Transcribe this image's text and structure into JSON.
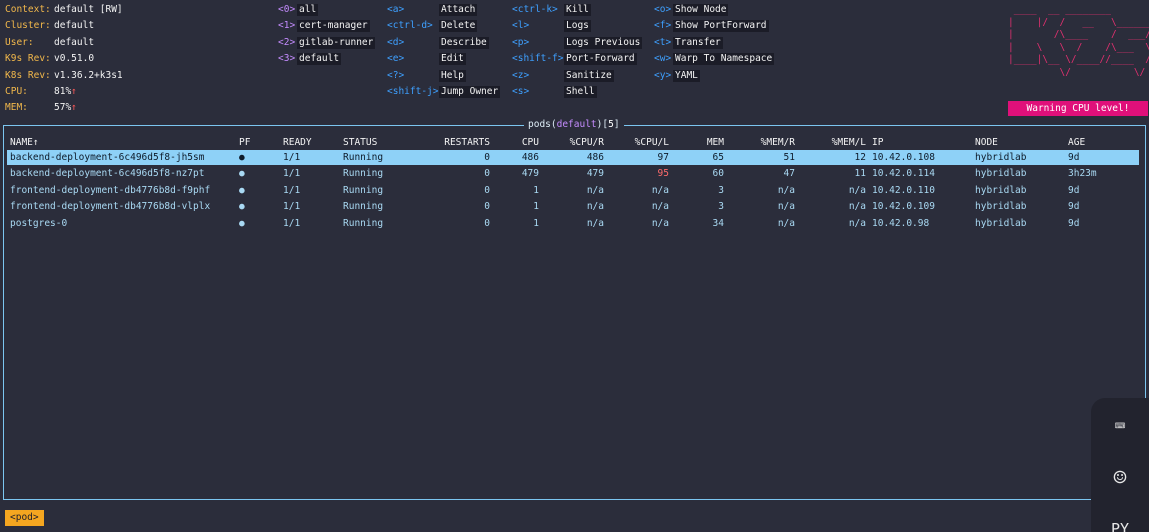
{
  "info": [
    {
      "label": "Context:",
      "value": "default [RW]",
      "key": "<0>",
      "ns": "all"
    },
    {
      "label": "Cluster:",
      "value": "default",
      "key": "<1>",
      "ns": "cert-manager"
    },
    {
      "label": "User:",
      "value": "default",
      "key": "<2>",
      "ns": "gitlab-runner"
    },
    {
      "label": "K9s Rev:",
      "value": "v0.51.0",
      "key": "<3>",
      "ns": "default"
    },
    {
      "label": "K8s Rev:",
      "value": "v1.36.2+k3s1"
    },
    {
      "label": "CPU:",
      "value": "81%",
      "arrow": "↑"
    },
    {
      "label": "MEM:",
      "value": "57%",
      "arrow": "↑"
    }
  ],
  "hotkeys_col1": [
    {
      "key": "<a>",
      "action": "Attach"
    },
    {
      "key": "<ctrl-d>",
      "action": "Delete"
    },
    {
      "key": "<d>",
      "action": "Describe"
    },
    {
      "key": "<e>",
      "action": "Edit"
    },
    {
      "key": "<?>",
      "action": "Help"
    },
    {
      "key": "<shift-j>",
      "action": "Jump Owner"
    }
  ],
  "hotkeys_col2": [
    {
      "key": "<ctrl-k>",
      "action": "Kill"
    },
    {
      "key": "<l>",
      "action": "Logs"
    },
    {
      "key": "<p>",
      "action": "Logs Previous"
    },
    {
      "key": "<shift-f>",
      "action": "Port-Forward"
    },
    {
      "key": "<z>",
      "action": "Sanitize"
    },
    {
      "key": "<s>",
      "action": "Shell"
    }
  ],
  "hotkeys_col3": [
    {
      "key": "<o>",
      "action": "Show Node"
    },
    {
      "key": "<f>",
      "action": "Show PortForward"
    },
    {
      "key": "<t>",
      "action": "Transfer"
    },
    {
      "key": "<w>",
      "action": "Warp To Namespace"
    },
    {
      "key": "<y>",
      "action": "YAML"
    }
  ],
  "logo_lines": [
    " ____  __ ________       ",
    "|    |/  /   __   \\______",
    "|       /\\____    /  ___/",
    "|    \\   \\  /    /\\___  \\",
    "|____|\\__ \\/____//____  /",
    "         \\/           \\/ "
  ],
  "warning": "Warning CPU level!",
  "pods": {
    "title_prefix": "pods(",
    "namespace": "default",
    "title_mid": ")[",
    "count": "5",
    "title_suffix": "]",
    "headers": {
      "name": "NAME↑",
      "pf": "PF",
      "ready": "READY",
      "status": "STATUS",
      "restarts": "RESTARTS",
      "cpu": "CPU",
      "cpu_r": "%CPU/R",
      "cpu_l": "%CPU/L",
      "mem": "MEM",
      "mem_r": "%MEM/R",
      "mem_l": "%MEM/L",
      "ip": "IP",
      "node": "NODE",
      "age": "AGE"
    },
    "rows": [
      {
        "name": "backend-deployment-6c496d5f8-jh5sm",
        "pf": "●",
        "ready": "1/1",
        "status": "Running",
        "restarts": "0",
        "cpu": "486",
        "cpu_r": "486",
        "cpu_l": "97",
        "mem": "65",
        "mem_r": "51",
        "mem_l": "12",
        "ip": "10.42.0.108",
        "node": "hybridlab",
        "age": "9d"
      },
      {
        "name": "backend-deployment-6c496d5f8-nz7pt",
        "pf": "●",
        "ready": "1/1",
        "status": "Running",
        "restarts": "0",
        "cpu": "479",
        "cpu_r": "479",
        "cpu_l": "95",
        "mem": "60",
        "mem_r": "47",
        "mem_l": "11",
        "ip": "10.42.0.114",
        "node": "hybridlab",
        "age": "3h23m"
      },
      {
        "name": "frontend-deployment-db4776b8d-f9phf",
        "pf": "●",
        "ready": "1/1",
        "status": "Running",
        "restarts": "0",
        "cpu": "1",
        "cpu_r": "n/a",
        "cpu_l": "n/a",
        "mem": "3",
        "mem_r": "n/a",
        "mem_l": "n/a",
        "ip": "10.42.0.110",
        "node": "hybridlab",
        "age": "9d"
      },
      {
        "name": "frontend-deployment-db4776b8d-vlplx",
        "pf": "●",
        "ready": "1/1",
        "status": "Running",
        "restarts": "0",
        "cpu": "1",
        "cpu_r": "n/a",
        "cpu_l": "n/a",
        "mem": "3",
        "mem_r": "n/a",
        "mem_l": "n/a",
        "ip": "10.42.0.109",
        "node": "hybridlab",
        "age": "9d"
      },
      {
        "name": "postgres-0",
        "pf": "●",
        "ready": "1/1",
        "status": "Running",
        "restarts": "0",
        "cpu": "1",
        "cpu_r": "n/a",
        "cpu_l": "n/a",
        "mem": "34",
        "mem_r": "n/a",
        "mem_l": "n/a",
        "ip": "10.42.0.98",
        "node": "hybridlab",
        "age": "9d"
      }
    ]
  },
  "crumb": "<pod>",
  "side_panel": {
    "keyboard_icon": "⌨",
    "emoji_icon": "☺",
    "partial_text": "PY"
  },
  "colors": {
    "accent": "#8ed1f7",
    "warning_bg": "#e0107a",
    "crumb_bg": "#f4a620"
  }
}
